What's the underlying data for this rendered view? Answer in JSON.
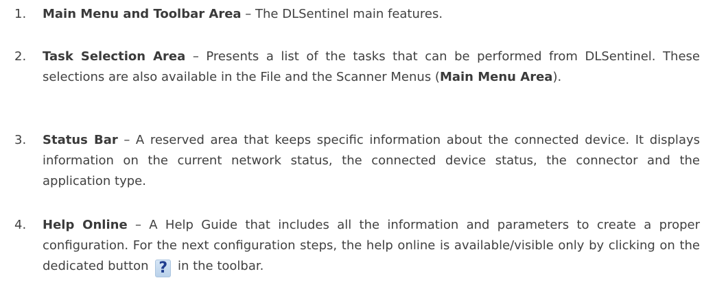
{
  "items": [
    {
      "number": "1.",
      "title": "Main Menu and Toolbar Area",
      "text": " – The DLSentinel main features."
    },
    {
      "number": "2.",
      "title": "Task Selection Area",
      "text_a": " – Presents a list of the tasks that can be performed from DLSentinel. These selections are also available in the File and the Scanner Menus (",
      "inline_bold": "Main Menu Area",
      "text_b": ")."
    },
    {
      "number": "3.",
      "title": "Status Bar",
      "text": " – A reserved area that keeps specific information about the connected device. It displays information on the current network status, the connected device status, the connector and the application type."
    },
    {
      "number": "4.",
      "title": "Help Online",
      "text_a": " – A Help Guide that includes all the information and parameters to create a proper configuration. For the next configuration steps, the help online is available/visible only by clicking on the dedicated button ",
      "icon_glyph": "?",
      "icon": "question-mark-icon",
      "text_b": " in the toolbar."
    }
  ],
  "colors": {
    "text": "#404040",
    "icon_fg": "#1f3d8f",
    "icon_bg": "#c7dcf0"
  }
}
